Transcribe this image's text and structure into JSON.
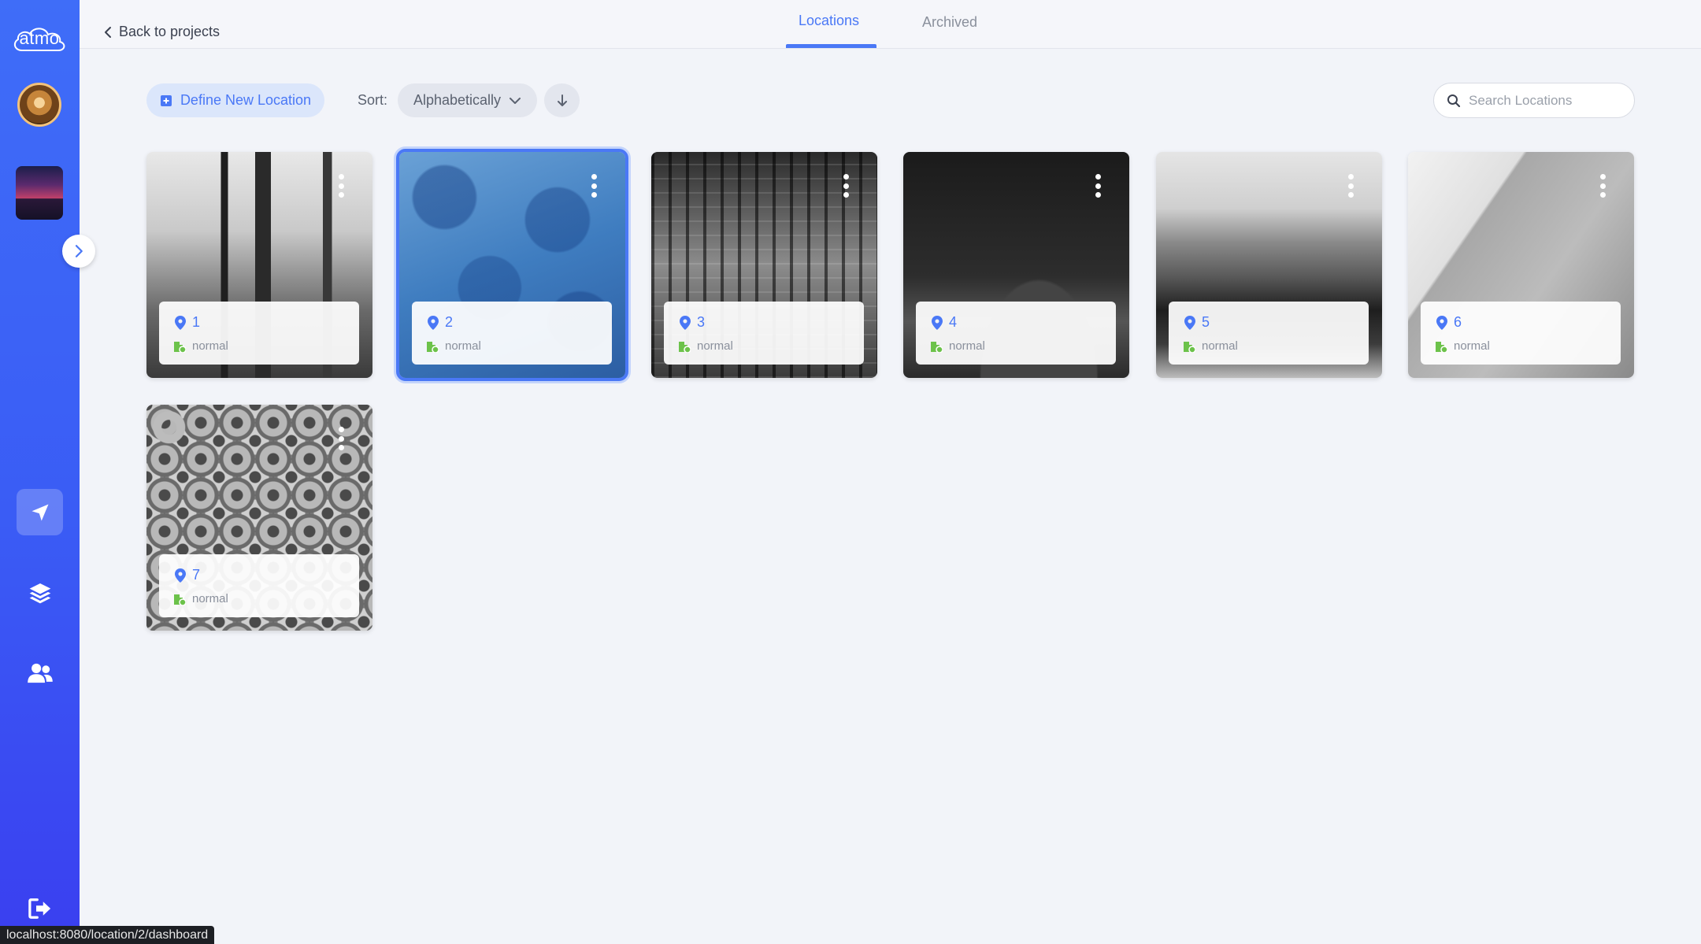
{
  "sidebar": {
    "logo_text": "atmo",
    "icons": {
      "locations": "navigation-arrow-icon",
      "layers": "layers-icon",
      "users": "users-icon",
      "logout": "logout-icon",
      "expand": "chevron-right-icon"
    }
  },
  "topbar": {
    "back_label": "Back to projects",
    "tabs": [
      {
        "label": "Locations",
        "active": true
      },
      {
        "label": "Archived",
        "active": false
      }
    ]
  },
  "toolbar": {
    "define_label": "Define New Location",
    "sort_label": "Sort:",
    "sort_value": "Alphabetically",
    "sort_direction": "descending",
    "search_placeholder": "Search Locations"
  },
  "cards": [
    {
      "name": "1",
      "status": "normal",
      "selected": false
    },
    {
      "name": "2",
      "status": "normal",
      "selected": true
    },
    {
      "name": "3",
      "status": "normal",
      "selected": false
    },
    {
      "name": "4",
      "status": "normal",
      "selected": false
    },
    {
      "name": "5",
      "status": "normal",
      "selected": false
    },
    {
      "name": "6",
      "status": "normal",
      "selected": false
    },
    {
      "name": "7",
      "status": "normal",
      "selected": false
    }
  ],
  "status_bar": {
    "url": "localhost:8080/location/2/dashboard"
  },
  "colors": {
    "accent": "#4a78f6",
    "sidebar_top": "#3f6df8",
    "sidebar_bottom": "#3a3ff0",
    "status_green": "#6cc24a"
  }
}
